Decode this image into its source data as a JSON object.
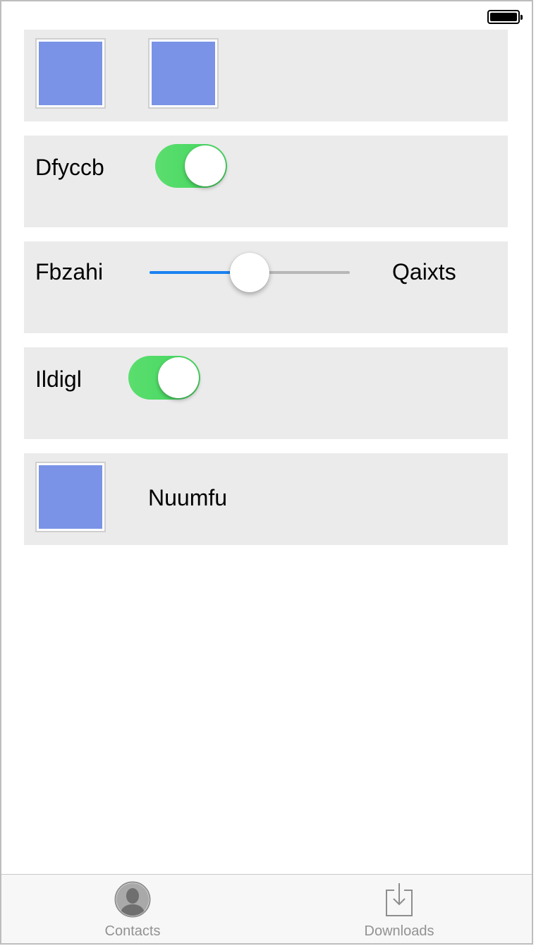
{
  "status_bar": {
    "battery_icon": "battery-full-icon"
  },
  "cards": [
    {
      "kind": "image-pair",
      "images": [
        "image-placeholder",
        "image-placeholder"
      ]
    },
    {
      "kind": "toggle-row",
      "label": "Dfyccb",
      "toggle_on": true
    },
    {
      "kind": "slider-row",
      "left_label": "Fbzahi",
      "right_label": "Qaixts",
      "slider_value": 0.5
    },
    {
      "kind": "toggle-row",
      "label": "Ildigl",
      "toggle_on": true
    },
    {
      "kind": "image-label-row",
      "image": "image-placeholder",
      "label": "Nuumfu"
    }
  ],
  "tab_bar": {
    "tabs": [
      {
        "label": "Contacts",
        "icon": "contact-icon"
      },
      {
        "label": "Downloads",
        "icon": "download-icon"
      }
    ]
  },
  "colors": {
    "card_background": "#ebebeb",
    "placeholder_fill": "#7a93e6",
    "toggle_on": "#4cd964",
    "slider_fill": "#1a82f0",
    "tab_label": "#929292"
  }
}
